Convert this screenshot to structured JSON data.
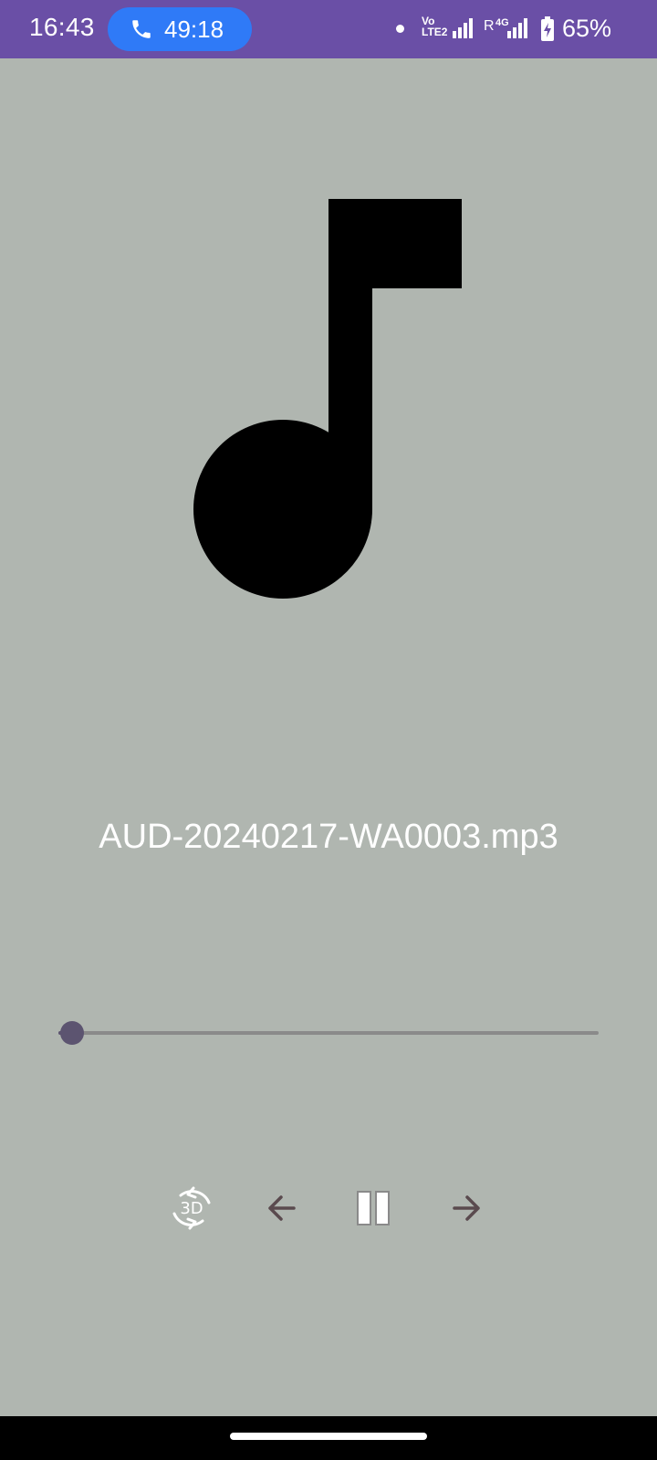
{
  "status_bar": {
    "time": "16:43",
    "call_duration": "49:18",
    "volte_line1": "Vo",
    "volte_line2": "LTE2",
    "roaming": "R",
    "network": "4G",
    "battery_percent": "65%",
    "background_color": "#6a4fa6",
    "call_pill_color": "#2f7af7",
    "icons": [
      "phone-icon",
      "notification-dot",
      "volte-icon",
      "signal-icon",
      "battery-charging-icon"
    ]
  },
  "player": {
    "track_title": "AUD-20240217-WA0003.mp3",
    "progress": 0.025,
    "album_art_icon": "music-note-icon",
    "controls": {
      "effect_label": "3D",
      "icons": [
        "3d-rotate-icon",
        "arrow-left-icon",
        "pause-icon",
        "arrow-right-icon"
      ]
    },
    "background_color": "#b0b6b0",
    "accent_color": "#5c5470"
  },
  "nav_bar": {
    "background_color": "#000000"
  }
}
